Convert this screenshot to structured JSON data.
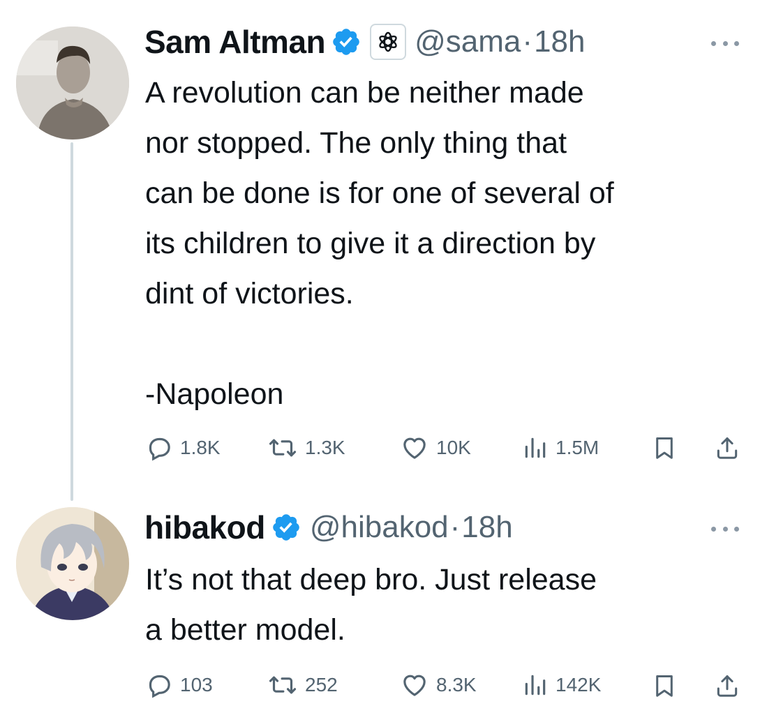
{
  "tweets": [
    {
      "author": {
        "name": "Sam Altman",
        "handle": "@sama",
        "time": "18h",
        "verified": true,
        "affiliate_badge": "openai-logo-icon"
      },
      "text": "A revolution can be neither made\nnor stopped. The only thing that\ncan be done is for one of several of\nits children to give it a direction by\ndint of victories.\n\n-Napoleon",
      "stats": {
        "replies": "1.8K",
        "retweets": "1.3K",
        "likes": "10K",
        "views": "1.5M"
      }
    },
    {
      "author": {
        "name": "hibakod",
        "handle": "@hibakod",
        "time": "18h",
        "verified": true
      },
      "text": "It’s not that deep bro. Just release\na better model.",
      "stats": {
        "replies": "103",
        "retweets": "252",
        "likes": "8.3K",
        "views": "142K"
      }
    }
  ],
  "separator": "·",
  "colors": {
    "text": "#0f1419",
    "muted": "#536471",
    "verified": "#1d9bf0",
    "thread_line": "#cfd9de"
  }
}
